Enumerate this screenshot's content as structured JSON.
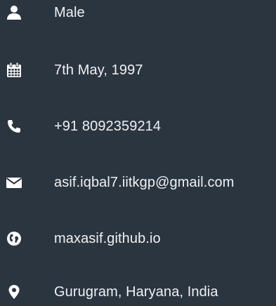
{
  "profile": {
    "items": [
      {
        "icon": "user-icon",
        "text": "Male"
      },
      {
        "icon": "calendar-icon",
        "text": "7th May, 1997"
      },
      {
        "icon": "phone-icon",
        "text": "+91 8092359214"
      },
      {
        "icon": "envelope-icon",
        "text": "asif.iqbal7.iitkgp@gmail.com"
      },
      {
        "icon": "globe-icon",
        "text": "maxasif.github.io"
      },
      {
        "icon": "map-marker-icon",
        "text": "Gurugram, Haryana, India"
      }
    ]
  },
  "colors": {
    "background": "#2b3540",
    "text": "#eef1f4",
    "icon": "#ffffff"
  }
}
